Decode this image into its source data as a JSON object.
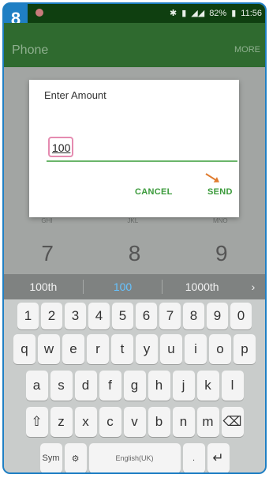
{
  "badge": "8",
  "status": {
    "battery": "82%",
    "time": "11:56"
  },
  "app": {
    "title": "Phone",
    "more": "MORE"
  },
  "dialog": {
    "title": "Enter Amount",
    "amount_value": "100",
    "cancel": "CANCEL",
    "send": "SEND"
  },
  "dialpad_letters": [
    "GHI",
    "JKL",
    "MNO"
  ],
  "dialpad_digits": [
    "7",
    "8",
    "9"
  ],
  "suggestions": [
    "100th",
    "100",
    "1000th"
  ],
  "keyboard": {
    "numbers": [
      "1",
      "2",
      "3",
      "4",
      "5",
      "6",
      "7",
      "8",
      "9",
      "0"
    ],
    "row1": [
      "q",
      "w",
      "e",
      "r",
      "t",
      "y",
      "u",
      "i",
      "o",
      "p"
    ],
    "row2": [
      "a",
      "s",
      "d",
      "f",
      "g",
      "h",
      "j",
      "k",
      "l"
    ],
    "row3": [
      "z",
      "x",
      "c",
      "v",
      "b",
      "n",
      "m"
    ],
    "sym": "Sym",
    "space": "English(UK)"
  },
  "colors": {
    "accent": "#1f7fc4",
    "button_green": "#3a9a3a",
    "highlight_pink": "#e58bb0"
  }
}
